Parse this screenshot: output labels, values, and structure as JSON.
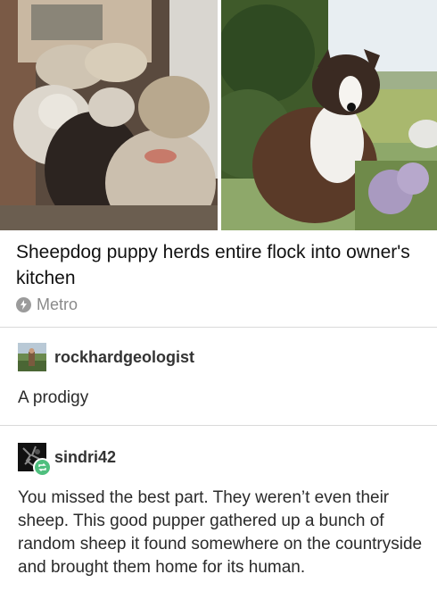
{
  "post": {
    "headline": "Sheepdog puppy herds entire flock into owner's kitchen",
    "source": "Metro",
    "source_icon": "lightning-bolt-icon"
  },
  "comments": [
    {
      "username": "rockhardgeologist",
      "text": "A prodigy",
      "avatar_icon": "landscape-avatar"
    },
    {
      "username": "sindri42",
      "text": "You missed the best part. They weren’t even their sheep. This good pupper gathered up a bunch of random sheep it found somewhere on the countryside and brought them home for its human.",
      "avatar_icon": "dark-avatar",
      "badge_icon": "reblog-icon"
    }
  ],
  "colors": {
    "reblog_badge": "#4fbf7e",
    "source_text": "#8a8a8a",
    "divider": "#d9d9d9"
  }
}
